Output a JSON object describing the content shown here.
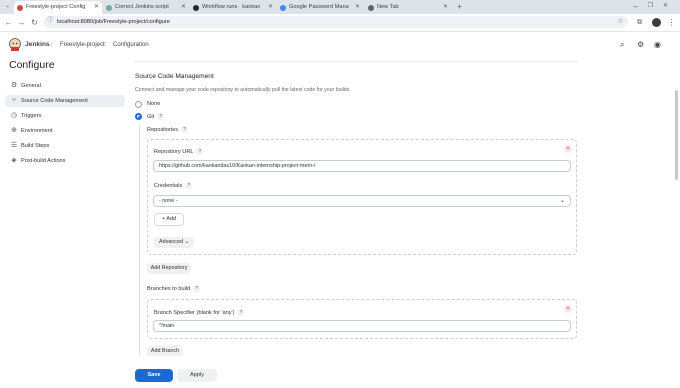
{
  "browser": {
    "tabs": [
      {
        "label": "Freestyle-project Config",
        "active": true,
        "favicon_color": "#d24939"
      },
      {
        "label": "Correct Jenkins script",
        "active": false,
        "favicon_color": "#74aa9c"
      },
      {
        "label": "Workflow runs · kankan",
        "active": false,
        "favicon_color": "#24292f"
      },
      {
        "label": "Google Password Mana",
        "active": false,
        "favicon_color": "#4285f4"
      },
      {
        "label": "New Tab",
        "active": false,
        "favicon_color": "#5f6368"
      }
    ],
    "url": "localhost:8080/job/Freestyle-project/configure"
  },
  "header": {
    "brand": "Jenkins",
    "breadcrumbs": [
      "Freestyle-project",
      "Configuration"
    ]
  },
  "sidebar": {
    "title": "Configure",
    "items": [
      {
        "label": "General",
        "icon": "gear-icon"
      },
      {
        "label": "Source Code Management",
        "icon": "branch-icon"
      },
      {
        "label": "Triggers",
        "icon": "clock-icon"
      },
      {
        "label": "Environment",
        "icon": "globe-icon"
      },
      {
        "label": "Build Steps",
        "icon": "list-icon"
      },
      {
        "label": "Post-build Actions",
        "icon": "cube-icon"
      }
    ],
    "active_index": 1
  },
  "scm": {
    "title": "Source Code Management",
    "description": "Connect and manage your code repository to automatically pull the latest code for your builds.",
    "option_none": "None",
    "option_git": "Git",
    "selected": "Git",
    "repositories_label": "Repositories",
    "repository_url_label": "Repository URL",
    "repository_url_value": "https://github.com/kankandas10/Kankan-internship-project-mern-/",
    "credentials_label": "Credentials",
    "credentials_value": "- none -",
    "add_label": "Add",
    "advanced_label": "Advanced",
    "add_repository_label": "Add Repository",
    "branches_label": "Branches to build",
    "branch_specifier_label": "Branch Specifier (blank for 'any')",
    "branch_specifier_value": "*/main",
    "add_branch_label": "Add Branch"
  },
  "footer": {
    "save_label": "Save",
    "apply_label": "Apply"
  },
  "help_glyph": "?",
  "colors": {
    "accent": "#1a6ad1",
    "active_sidebar": "#eaeff3"
  }
}
